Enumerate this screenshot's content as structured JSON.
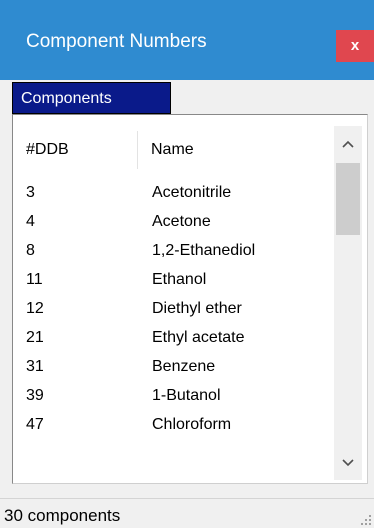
{
  "window": {
    "title": "Component Numbers",
    "close_label": "x"
  },
  "tabs": [
    {
      "label": "Components"
    }
  ],
  "table": {
    "columns": [
      "#DDB",
      "Name"
    ],
    "rows": [
      {
        "ddb": "3",
        "name": "Acetonitrile"
      },
      {
        "ddb": "4",
        "name": "Acetone"
      },
      {
        "ddb": "8",
        "name": "1,2-Ethanediol"
      },
      {
        "ddb": "11",
        "name": "Ethanol"
      },
      {
        "ddb": "12",
        "name": "Diethyl ether"
      },
      {
        "ddb": "21",
        "name": "Ethyl acetate"
      },
      {
        "ddb": "31",
        "name": "Benzene"
      },
      {
        "ddb": "39",
        "name": "1-Butanol"
      },
      {
        "ddb": "47",
        "name": "Chloroform"
      }
    ]
  },
  "scrollbar": {
    "up_icon": "chevron-up-icon",
    "down_icon": "chevron-down-icon"
  },
  "status": {
    "text": "30 components"
  },
  "colors": {
    "titlebar": "#2f8bd0",
    "close_button": "#e0474f",
    "active_tab": "#0a1a8a"
  }
}
